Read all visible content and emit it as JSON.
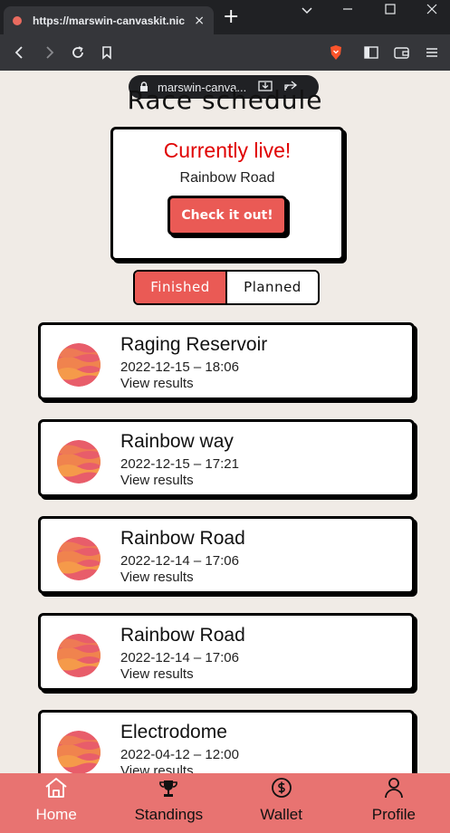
{
  "browser": {
    "tab_title": "https://marswin-canvaskit.nicol",
    "tab_close": "×",
    "new_tab": "+",
    "url": "marswin-canva..."
  },
  "page": {
    "title": "Race schedule",
    "live": {
      "heading": "Currently live!",
      "track": "Rainbow Road",
      "button_label": "Check it out!"
    },
    "toggle": {
      "finished": "Finished",
      "planned": "Planned",
      "selected": "Finished"
    },
    "races": [
      {
        "name": "Raging Reservoir",
        "datetime": "2022-12-15 – 18:06",
        "link": "View results"
      },
      {
        "name": "Rainbow way",
        "datetime": "2022-12-15 – 17:21",
        "link": "View results"
      },
      {
        "name": "Rainbow Road",
        "datetime": "2022-12-14 – 17:06",
        "link": "View results"
      },
      {
        "name": "Rainbow Road",
        "datetime": "2022-12-14 – 17:06",
        "link": "View results"
      },
      {
        "name": "Electrodome",
        "datetime": "2022-04-12 – 12:00",
        "link": "View results"
      }
    ]
  },
  "nav": {
    "home": "Home",
    "standings": "Standings",
    "wallet": "Wallet",
    "profile": "Profile",
    "active": "Home"
  },
  "colors": {
    "accent": "#ea5a55",
    "nav_bg": "#e87371",
    "page_bg": "#f0ebe6",
    "live_text": "#e00000"
  },
  "icons": {
    "home": "home-icon",
    "standings": "trophy-icon",
    "wallet": "dollar-circle-icon",
    "profile": "person-icon"
  }
}
